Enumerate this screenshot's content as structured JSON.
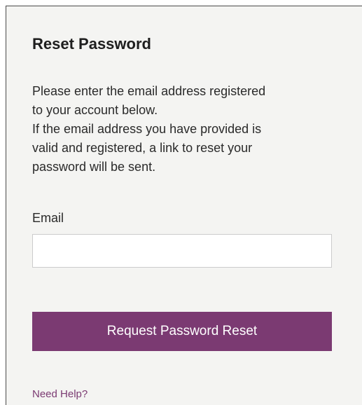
{
  "form": {
    "title": "Reset Password",
    "description_lines": [
      "Please enter the email address registered",
      "to your account below.",
      "If the email address you have provided is",
      "valid and registered, a link to reset your",
      "password will be sent."
    ],
    "email_label": "Email",
    "email_value": "",
    "email_placeholder": "",
    "submit_label": "Request Password Reset",
    "help_link": "Need Help?"
  },
  "colors": {
    "accent": "#7b3a72",
    "panel_background": "#f4f4f2",
    "input_border": "#cccccc"
  }
}
